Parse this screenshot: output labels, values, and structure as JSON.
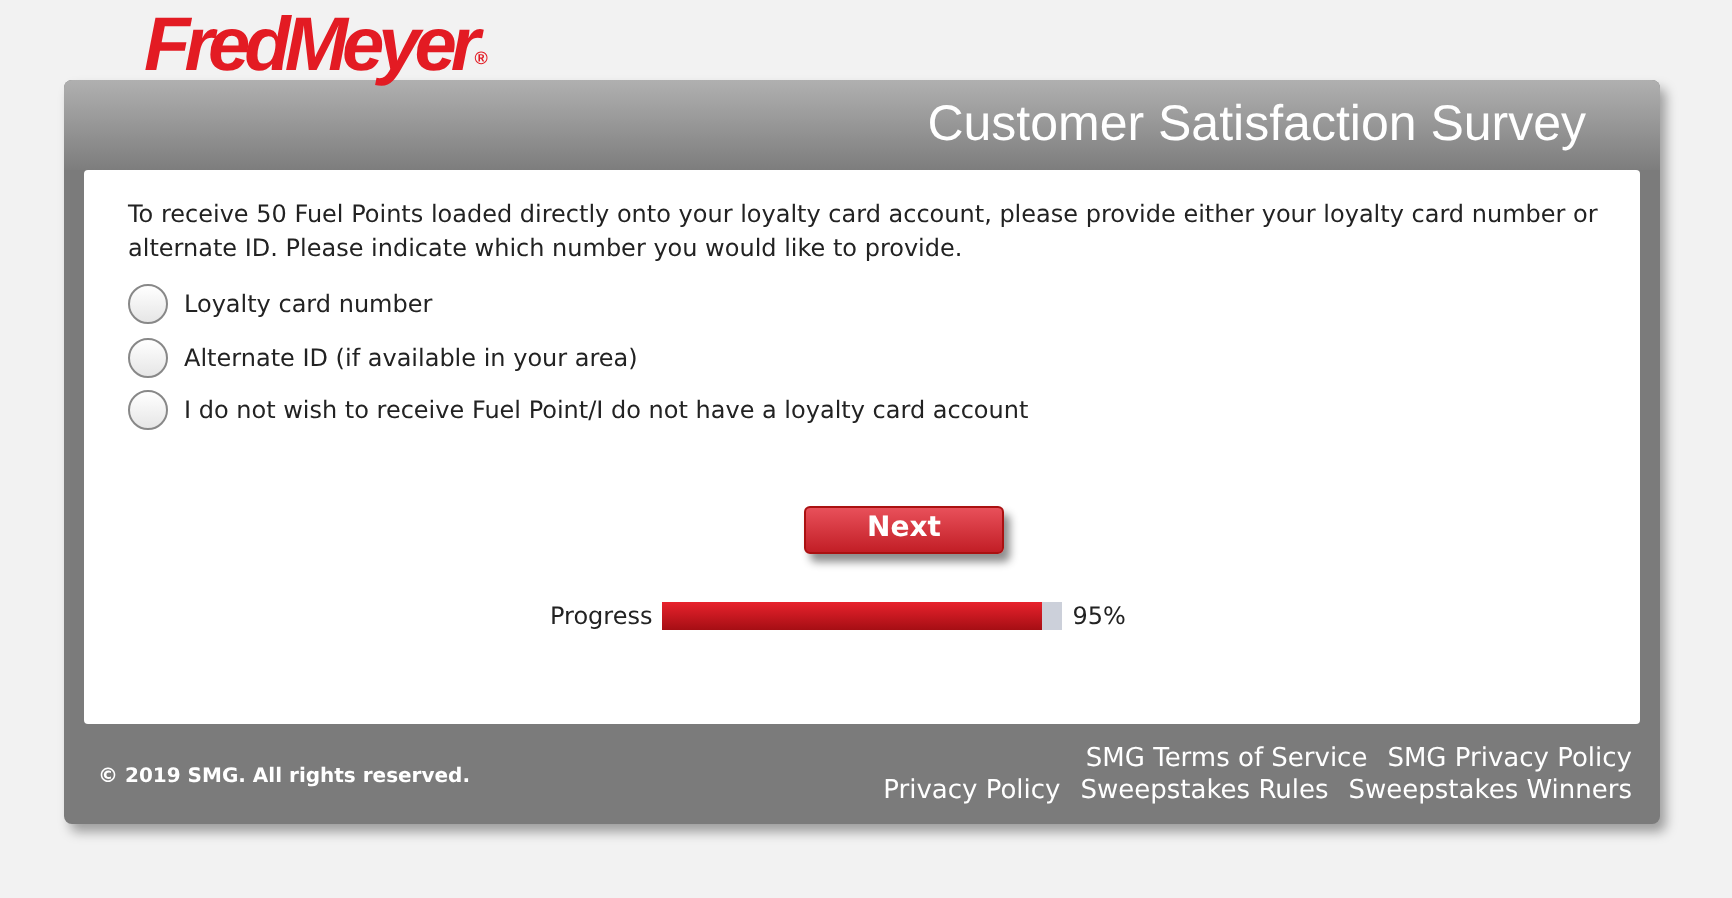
{
  "logo": {
    "text": "FredMeyer",
    "mark": "®"
  },
  "header": {
    "title": "Customer Satisfaction Survey"
  },
  "question": {
    "text": "To receive 50 Fuel Points loaded directly onto your loyalty card account, please provide either your loyalty card number or alternate ID. Please indicate which number you would like to provide.",
    "options": [
      {
        "label": "Loyalty card number",
        "selected": false
      },
      {
        "label": "Alternate ID (if available in your area)",
        "selected": false
      },
      {
        "label": "I do not wish to receive Fuel Point/I do not have a loyalty card account",
        "selected": false
      }
    ]
  },
  "next_button": "Next",
  "progress": {
    "label": "Progress",
    "level": 0.95,
    "reading": "95%"
  },
  "footer": {
    "copyright": "© 2019 SMG. All rights reserved.",
    "links_row_1": [
      "SMG Terms of Service",
      "SMG Privacy Policy"
    ],
    "links_row_2": [
      "Privacy Policy",
      "Sweepstakes Rules",
      "Sweepstakes Winners"
    ]
  }
}
